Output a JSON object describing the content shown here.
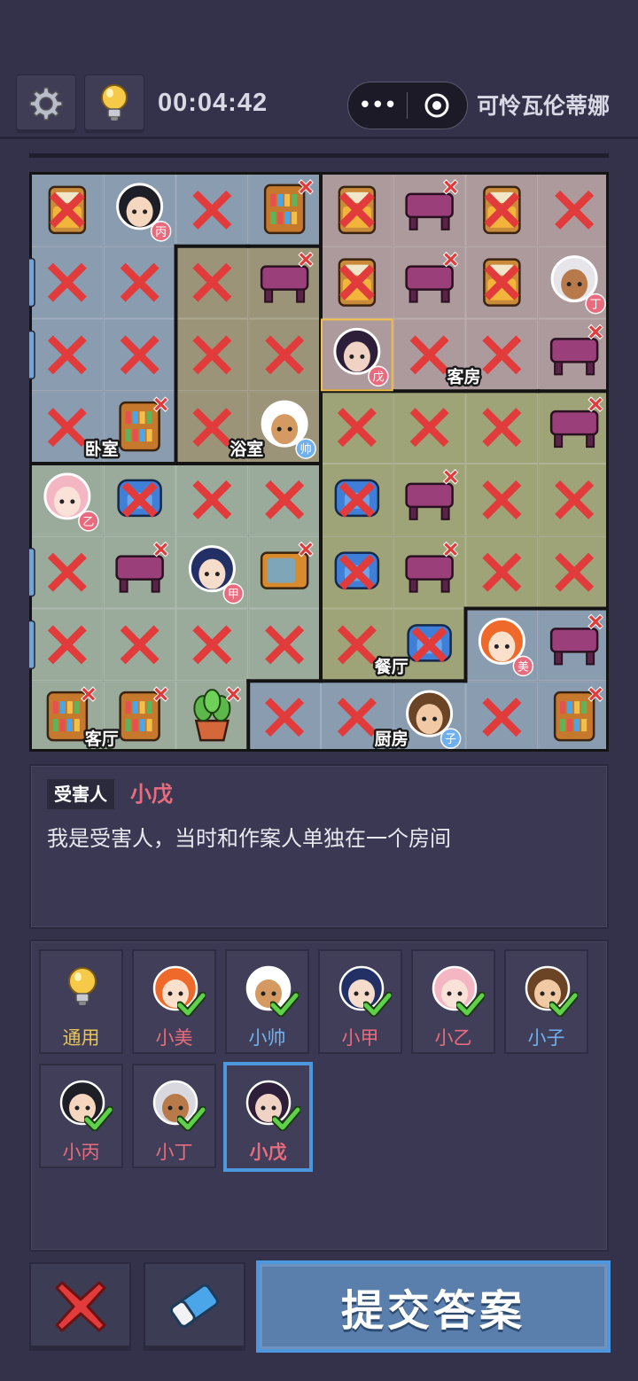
{
  "header": {
    "timer": "00:04:42",
    "more_glyph": "•••",
    "player_name": "可怜瓦伦蒂娜",
    "icons": [
      "gear-icon",
      "lightbulb-icon",
      "more-icon",
      "target-icon"
    ]
  },
  "colors": {
    "room_blue": "#8a9cb0",
    "room_tan": "#9c9478",
    "room_pink": "#ad9a9c",
    "room_olive": "#9ea378",
    "room_sage": "#9aab9c",
    "red_x": "#e13b3b",
    "text_pink": "#e86c7e",
    "text_blue": "#6fb0ef",
    "text_yellow": "#e8c55a",
    "accent": "#4c97dd"
  },
  "board": {
    "rows": 8,
    "cols": 8,
    "rooms": [
      {
        "name": "卧室",
        "color": "room_blue"
      },
      {
        "name": "浴室",
        "color": "room_tan"
      },
      {
        "name": "客房",
        "color": "room_pink"
      },
      {
        "name": "客厅",
        "color": "room_sage"
      },
      {
        "name": "餐厅",
        "color": "room_olive"
      },
      {
        "name": "厨房",
        "color": "room_blue"
      }
    ],
    "cells": [
      [
        "bed-x",
        "char:丙",
        "x",
        "bookshelf-x",
        "bed-x",
        "table-x",
        "bed-x",
        "x"
      ],
      [
        "x",
        "x",
        "x",
        "table-x",
        "bed-x",
        "table-x",
        "bed-x",
        "char:丁"
      ],
      [
        "x",
        "x",
        "x",
        "x",
        "char:戊",
        "x",
        "x",
        "table-x"
      ],
      [
        "x",
        "bookshelf-x",
        "x",
        "char:帅",
        "x",
        "x",
        "x",
        "table-x"
      ],
      [
        "char:乙",
        "sofa-x",
        "x",
        "x",
        "sofa-x",
        "table-x",
        "x",
        "x"
      ],
      [
        "x",
        "table-x",
        "char:甲",
        "tv-x",
        "sofa-x",
        "table-x",
        "x",
        "x"
      ],
      [
        "x",
        "x",
        "x",
        "x",
        "x",
        "sofa-x",
        "char:美",
        "table-x"
      ],
      [
        "bookshelf-x",
        "bookshelf-x",
        "plant-x",
        "x",
        "x",
        "char:子",
        "x",
        "bookshelf-x"
      ]
    ]
  },
  "clue": {
    "tag": "受害人",
    "name": "小戊",
    "text": "我是受害人，当时和作案人单独在一个房间"
  },
  "characters": [
    {
      "label": "通用",
      "color": "#e8c55a",
      "icon": "lightbulb-icon",
      "checked": false
    },
    {
      "label": "小美",
      "color": "#e86c7e",
      "icon": "orange-hair-girl",
      "checked": true
    },
    {
      "label": "小帅",
      "color": "#6fb0ef",
      "icon": "chef-boy",
      "checked": true
    },
    {
      "label": "小甲",
      "color": "#e86c7e",
      "icon": "glasses-girl",
      "checked": true
    },
    {
      "label": "小乙",
      "color": "#e86c7e",
      "icon": "cat-ear-girl",
      "checked": true
    },
    {
      "label": "小子",
      "color": "#6fb0ef",
      "icon": "brown-hair-boy",
      "checked": true
    },
    {
      "label": "小丙",
      "color": "#e86c7e",
      "icon": "black-hair-boy",
      "checked": true
    },
    {
      "label": "小丁",
      "color": "#e86c7e",
      "icon": "white-hair-boy",
      "checked": true
    },
    {
      "label": "小戊",
      "color": "#e86c7e",
      "icon": "purple-hair-girl",
      "checked": true,
      "selected": true
    }
  ],
  "actions": {
    "clear_icon": "red-x-icon",
    "eraser_icon": "eraser-icon",
    "submit_label": "提交答案"
  }
}
